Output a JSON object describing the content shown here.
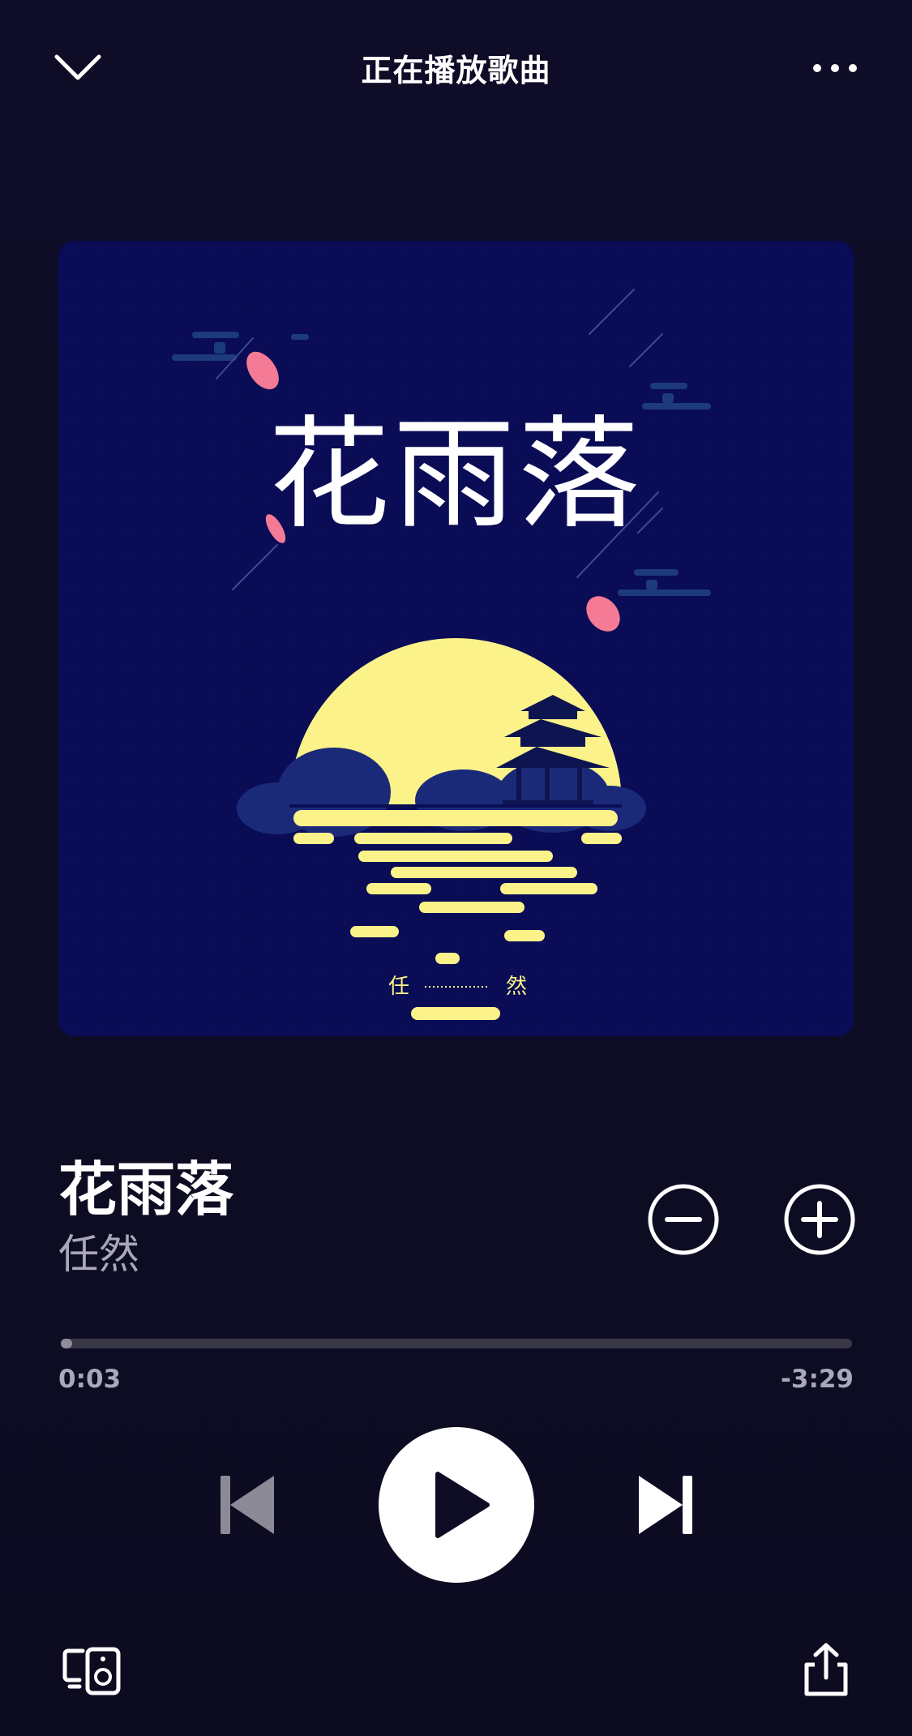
{
  "header": {
    "title": "正在播放歌曲",
    "collapse_icon": "chevron-down-icon",
    "more_icon": "more-horizontal-icon"
  },
  "album_art": {
    "cover_title": "花雨落",
    "cover_artist_left": "任",
    "cover_artist_right": "然",
    "background_color": "#0a0c55",
    "moon_color": "#fbf28a",
    "petal_color": "#f47a95"
  },
  "track": {
    "title": "花雨落",
    "artist": "任然"
  },
  "actions": {
    "remove_icon": "minus-circle-icon",
    "add_icon": "plus-circle-icon"
  },
  "progress": {
    "elapsed": "0:03",
    "remaining": "-3:29",
    "fraction": 0.014
  },
  "transport": {
    "previous_icon": "skip-previous-icon",
    "play_icon": "play-icon",
    "next_icon": "skip-next-icon"
  },
  "footer": {
    "devices_icon": "devices-icon",
    "share_icon": "share-icon"
  },
  "colors": {
    "background": "#0e0c24",
    "text_primary": "#ffffff",
    "text_secondary": "#a9a7b8",
    "track_bg": "#3a3848"
  }
}
